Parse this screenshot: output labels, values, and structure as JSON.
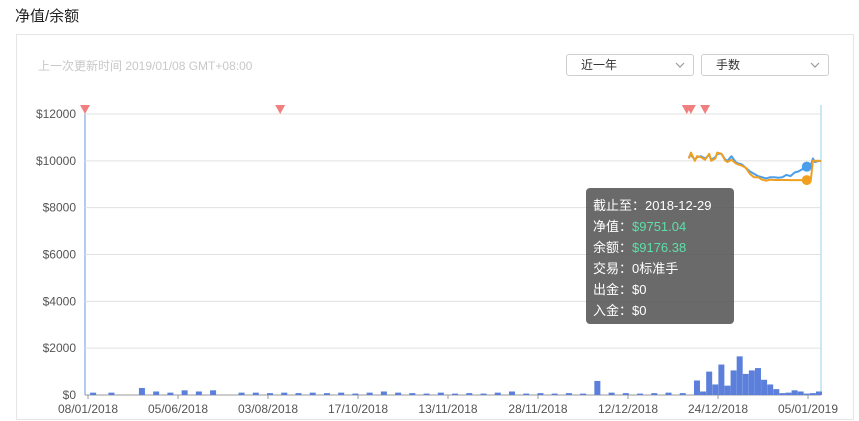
{
  "page": {
    "title": "净值/余额",
    "last_update": "上一次更新时间 2019/01/08 GMT+08:00"
  },
  "controls": {
    "period": "近一年",
    "unit": "手数"
  },
  "colors": {
    "net_value": "#4a9eea",
    "balance": "#f0a020",
    "bars": "#5b7fdb",
    "markers": "#f08080",
    "grid": "#e0e0e0"
  },
  "icons": [
    "chevron-down-icon",
    "triangle-down-icon"
  ],
  "chart_data": {
    "type": "line",
    "y_axis": {
      "min": 0,
      "max": 12000,
      "ticks": [
        0,
        2000,
        4000,
        6000,
        8000,
        10000,
        12000
      ],
      "tick_labels": [
        "$0",
        "$2000",
        "$4000",
        "$6000",
        "$8000",
        "$10000",
        "$12000"
      ]
    },
    "x_axis": {
      "start": "2018-01-08",
      "end": "2019-01-05",
      "tick_labels": [
        "08/01/2018",
        "05/06/2018",
        "03/08/2018",
        "17/10/2018",
        "13/11/2018",
        "28/11/2018",
        "12/12/2018",
        "24/12/2018",
        "05/01/2019"
      ]
    },
    "grid": true,
    "series": [
      {
        "key": "net_value",
        "dates": [
          "2018-11-01",
          "2018-11-02",
          "2018-11-04",
          "2018-11-05",
          "2018-11-07",
          "2018-11-09",
          "2018-11-11",
          "2018-11-12",
          "2018-11-14",
          "2018-11-15",
          "2018-11-17",
          "2018-11-19",
          "2018-11-20",
          "2018-11-22",
          "2018-11-24",
          "2018-11-25",
          "2018-11-27",
          "2018-11-29",
          "2018-12-01",
          "2018-12-03",
          "2018-12-05",
          "2018-12-07",
          "2018-12-09",
          "2018-12-11",
          "2018-12-13",
          "2018-12-15",
          "2018-12-17",
          "2018-12-19",
          "2018-12-21",
          "2018-12-23",
          "2018-12-25",
          "2018-12-27",
          "2018-12-29",
          "2018-12-31",
          "2019-01-01",
          "2019-01-02",
          "2019-01-04",
          "2019-01-05"
        ],
        "values": [
          10150,
          10250,
          10050,
          10150,
          10200,
          10100,
          10250,
          10050,
          10150,
          10300,
          10300,
          10050,
          10000,
          10200,
          9950,
          9900,
          9850,
          9700,
          9550,
          9450,
          9350,
          9300,
          9250,
          9300,
          9300,
          9280,
          9300,
          9400,
          9350,
          9500,
          9550,
          9650,
          9751,
          9800,
          10100,
          9950,
          10000,
          9980
        ]
      },
      {
        "key": "balance",
        "dates": [
          "2018-11-01",
          "2018-11-02",
          "2018-11-04",
          "2018-11-05",
          "2018-11-07",
          "2018-11-09",
          "2018-11-11",
          "2018-11-12",
          "2018-11-14",
          "2018-11-15",
          "2018-11-17",
          "2018-11-19",
          "2018-11-20",
          "2018-11-22",
          "2018-11-24",
          "2018-11-25",
          "2018-11-27",
          "2018-11-29",
          "2018-12-01",
          "2018-12-03",
          "2018-12-05",
          "2018-12-07",
          "2018-12-09",
          "2018-12-11",
          "2018-12-13",
          "2018-12-15",
          "2018-12-17",
          "2018-12-19",
          "2018-12-21",
          "2018-12-23",
          "2018-12-25",
          "2018-12-27",
          "2018-12-29",
          "2018-12-31",
          "2019-01-01",
          "2019-01-02",
          "2019-01-04",
          "2019-01-05"
        ],
        "values": [
          10100,
          10350,
          10000,
          10200,
          10150,
          10050,
          10300,
          10000,
          10100,
          10350,
          10300,
          10000,
          9950,
          10050,
          9900,
          9850,
          9800,
          9700,
          9450,
          9300,
          9300,
          9200,
          9150,
          9200,
          9180,
          9180,
          9180,
          9180,
          9176,
          9176,
          9176,
          9176,
          9176,
          9176,
          10000,
          10000,
          10000,
          9980
        ]
      },
      {
        "key": "trade_volume",
        "type": "bar",
        "dates": [
          "2018-01-12",
          "2018-01-21",
          "2018-02-05",
          "2018-02-12",
          "2018-02-19",
          "2018-02-26",
          "2018-03-05",
          "2018-03-12",
          "2018-03-26",
          "2018-04-02",
          "2018-04-09",
          "2018-04-16",
          "2018-04-23",
          "2018-04-30",
          "2018-05-07",
          "2018-05-14",
          "2018-05-21",
          "2018-05-28",
          "2018-06-04",
          "2018-06-11",
          "2018-06-18",
          "2018-06-25",
          "2018-07-02",
          "2018-07-09",
          "2018-07-16",
          "2018-07-23",
          "2018-07-30",
          "2018-08-06",
          "2018-08-13",
          "2018-08-20",
          "2018-08-27",
          "2018-09-03",
          "2018-09-10",
          "2018-09-17",
          "2018-09-24",
          "2018-10-01",
          "2018-10-08",
          "2018-10-15",
          "2018-10-22",
          "2018-10-29",
          "2018-11-05",
          "2018-11-08",
          "2018-11-11",
          "2018-11-14",
          "2018-11-17",
          "2018-11-20",
          "2018-11-23",
          "2018-11-26",
          "2018-11-29",
          "2018-12-02",
          "2018-12-05",
          "2018-12-08",
          "2018-12-11",
          "2018-12-14",
          "2018-12-17",
          "2018-12-20",
          "2018-12-23",
          "2018-12-26",
          "2018-12-29",
          "2019-01-01",
          "2019-01-04"
        ],
        "values": [
          100,
          100,
          300,
          150,
          100,
          200,
          150,
          200,
          100,
          100,
          80,
          100,
          80,
          100,
          80,
          100,
          60,
          100,
          150,
          100,
          80,
          60,
          100,
          60,
          80,
          60,
          100,
          150,
          60,
          80,
          60,
          80,
          60,
          600,
          100,
          80,
          60,
          80,
          100,
          80,
          620,
          150,
          1000,
          450,
          1300,
          400,
          1050,
          1650,
          900,
          1050,
          1150,
          650,
          450,
          250,
          80,
          100,
          200,
          150,
          60,
          80,
          150
        ]
      }
    ],
    "markers": [
      "2018-01-08",
      "2018-04-14",
      "2018-10-31",
      "2018-11-02",
      "2018-11-09"
    ],
    "hover_date": "2018-12-29"
  },
  "tooltip": {
    "date_label": "截止至：",
    "date": "2018-12-29",
    "net_label": "净值：",
    "net": "$9751.04",
    "balance_label": "余额：",
    "balance": "$9176.38",
    "trade_label": "交易：",
    "trade": "0标准手",
    "withdraw_label": "出金：",
    "withdraw": "$0",
    "deposit_label": "入金：",
    "deposit": "$0"
  }
}
